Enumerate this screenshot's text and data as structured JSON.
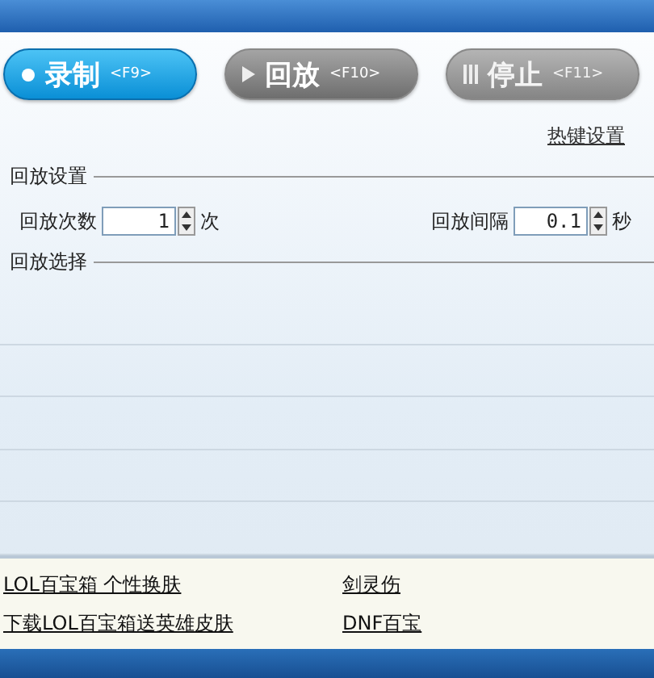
{
  "buttons": [
    {
      "kind": "record",
      "label": "录制",
      "hotkey": "<F9>",
      "selected": true,
      "disabled": false
    },
    {
      "kind": "play",
      "label": "回放",
      "hotkey": "<F10>",
      "selected": false,
      "disabled": false
    },
    {
      "kind": "stop",
      "label": "停止",
      "hotkey": "<F11>",
      "selected": false,
      "disabled": true
    }
  ],
  "hotkey_link": "热键设置",
  "playback_settings": {
    "title": "回放设置",
    "count_label": "回放次数",
    "count_value": "1",
    "count_unit": "次",
    "interval_label": "回放间隔",
    "interval_value": "0.1",
    "interval_unit": "秒"
  },
  "playback_selection": {
    "title": "回放选择"
  },
  "links": [
    {
      "text": "LOL百宝箱 个性换肤"
    },
    {
      "text": "剑灵伤"
    },
    {
      "text": "下载LOL百宝箱送英雄皮肤"
    },
    {
      "text": "DNF百宝"
    }
  ]
}
